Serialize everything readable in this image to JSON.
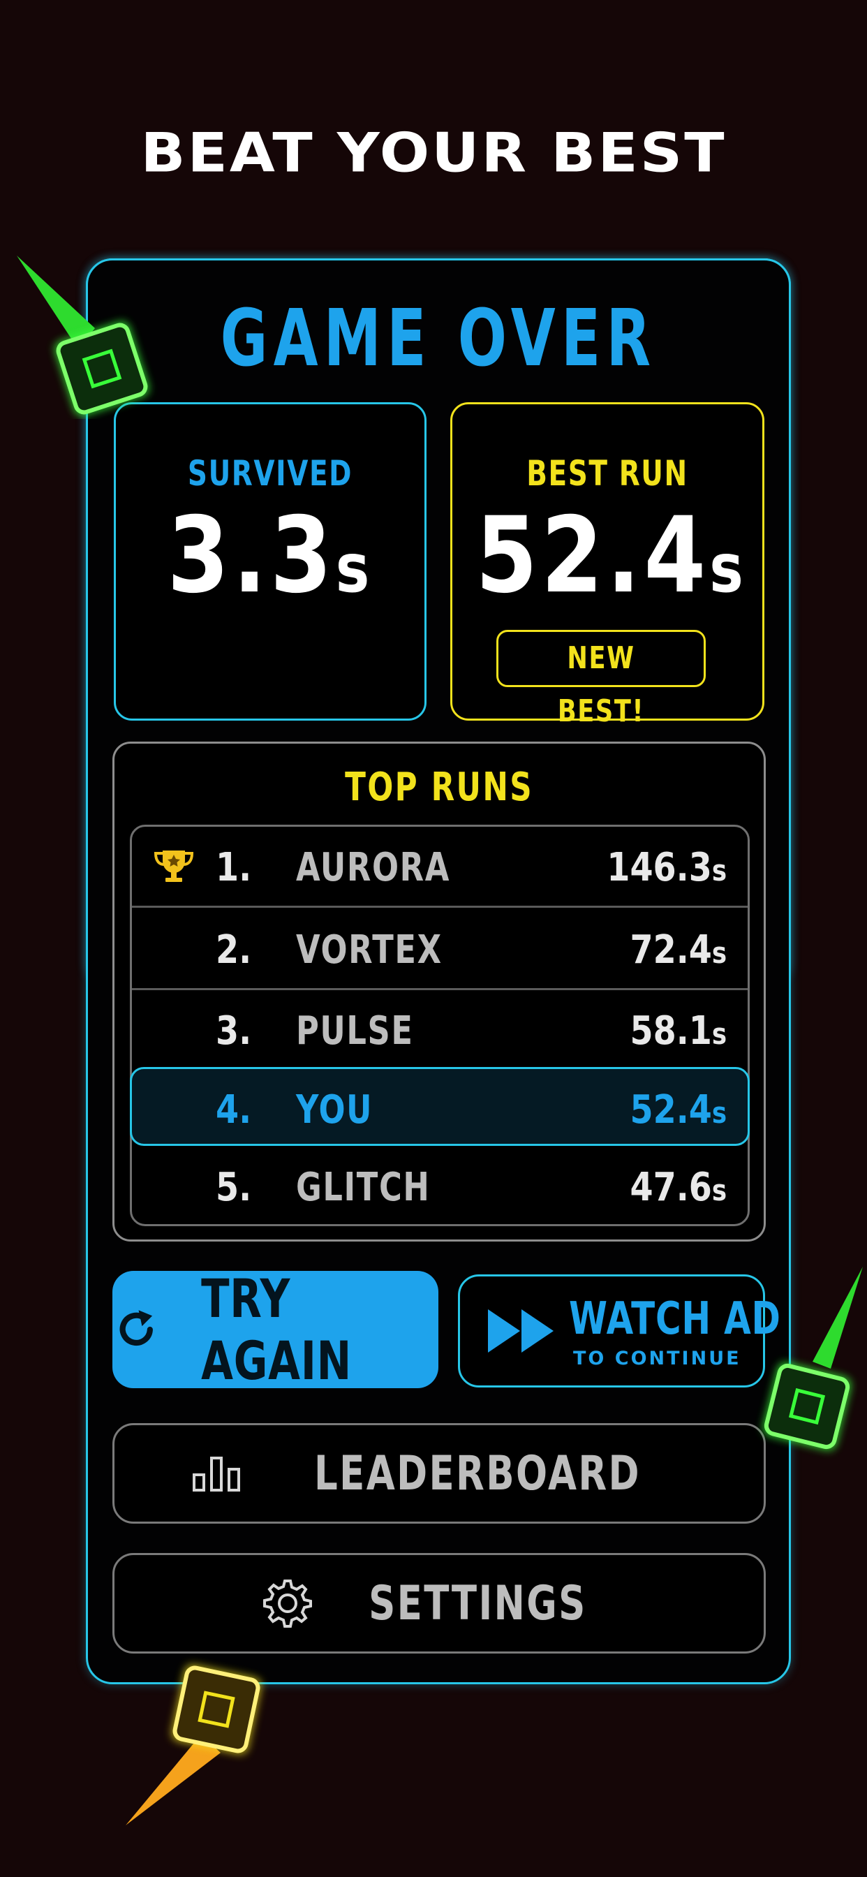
{
  "headline": "BEAT YOUR BEST",
  "panel": {
    "title": "GAME OVER",
    "survived": {
      "label": "SURVIVED",
      "value": "3.3",
      "unit": "s"
    },
    "best_run": {
      "label": "BEST RUN",
      "value": "52.4",
      "unit": "s",
      "badge": "NEW BEST!"
    }
  },
  "top_runs": {
    "title": "TOP RUNS",
    "rows": [
      {
        "rank": "1.",
        "name": "AURORA",
        "time": "146.3",
        "unit": "s",
        "icon": "trophy-icon"
      },
      {
        "rank": "2.",
        "name": "VORTEX",
        "time": "72.4",
        "unit": "s"
      },
      {
        "rank": "3.",
        "name": "PULSE",
        "time": "58.1",
        "unit": "s"
      },
      {
        "rank": "4.",
        "name": "YOU",
        "time": "52.4",
        "unit": "s",
        "highlight": true
      },
      {
        "rank": "5.",
        "name": "GLITCH",
        "time": "47.6",
        "unit": "s"
      }
    ]
  },
  "buttons": {
    "try_again": {
      "label": "TRY AGAIN",
      "icon": "restart-icon"
    },
    "watch_ad": {
      "label": "WATCH AD",
      "sublabel": "TO CONTINUE",
      "icon": "fast-forward-icon"
    },
    "leaderboard": {
      "label": "LEADERBOARD",
      "icon": "bar-chart-icon"
    },
    "settings": {
      "label": "SETTINGS",
      "icon": "gear-icon"
    }
  },
  "colors": {
    "background": "#150607",
    "cyan": "#27c6e8",
    "blue_text": "#1ea3ec",
    "yellow": "#f2e21c",
    "green": "#39ff3a",
    "orange": "#f5a21c"
  }
}
